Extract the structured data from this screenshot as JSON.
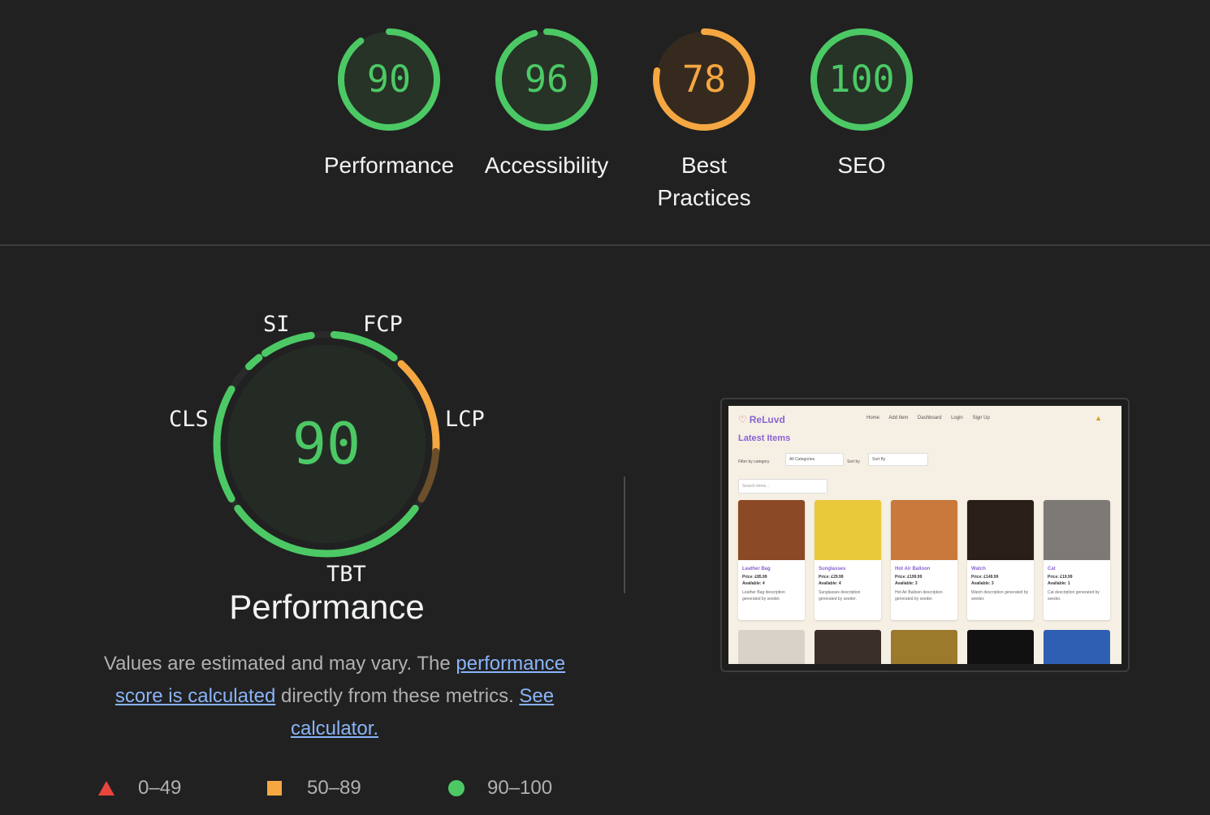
{
  "colors": {
    "pass": "#4cc965",
    "average": "#f5a742",
    "fail": "#e8453c",
    "pass_bg": "#263326",
    "average_bg": "#362a1e"
  },
  "categories": [
    {
      "score": "90",
      "label": "Performance",
      "value": 90,
      "rating": "pass"
    },
    {
      "score": "96",
      "label": "Accessibility",
      "value": 96,
      "rating": "pass"
    },
    {
      "score": "78",
      "label": "Best Practices",
      "value": 78,
      "rating": "average"
    },
    {
      "score": "100",
      "label": "SEO",
      "value": 100,
      "rating": "pass"
    }
  ],
  "performance": {
    "score": "90",
    "title": "Performance",
    "metrics": [
      {
        "label": "SI",
        "rating": "pass"
      },
      {
        "label": "FCP",
        "rating": "pass"
      },
      {
        "label": "LCP",
        "rating": "average"
      },
      {
        "label": "TBT",
        "rating": "pass"
      },
      {
        "label": "CLS",
        "rating": "pass"
      }
    ],
    "description_prefix": "Values are estimated and may vary. The ",
    "link_score": "performance score is calculated",
    "description_middle": " directly from these metrics. ",
    "link_calculator": "See calculator."
  },
  "legend": [
    {
      "range": "0–49",
      "icon": "triangle-icon"
    },
    {
      "range": "50–89",
      "icon": "square-icon"
    },
    {
      "range": "90–100",
      "icon": "circle-icon"
    }
  ],
  "screenshot": {
    "logo": "ReLuvd",
    "nav": [
      "Home",
      "Add Item",
      "Dashboard",
      "Login",
      "Sign Up"
    ],
    "heading": "Latest Items",
    "filter_label": "Filter by category",
    "filter_value": "All Categories",
    "sort_label": "Sort by",
    "sort_value": "Sort By",
    "search_placeholder": "Search items...",
    "items": [
      {
        "title": "Leather Bag",
        "price": "Price: £85.99",
        "available": "Available: 4",
        "desc": "Leather Bag description generated by seeder.",
        "color": "#8b4a25"
      },
      {
        "title": "Sunglasses",
        "price": "Price: £29.99",
        "available": "Available: 4",
        "desc": "Sunglasses description generated by seeder.",
        "color": "#e9c93a"
      },
      {
        "title": "Hot Air Balloon",
        "price": "Price: £199.99",
        "available": "Available: 3",
        "desc": "Hot Air Balloon description generated by seeder.",
        "color": "#c9793c"
      },
      {
        "title": "Watch",
        "price": "Price: £149.99",
        "available": "Available: 3",
        "desc": "Watch description generated by seeder.",
        "color": "#2a1f18"
      },
      {
        "title": "Cat",
        "price": "Price: £19.99",
        "available": "Available: 1",
        "desc": "Cat description generated by seeder.",
        "color": "#7d7a76"
      }
    ],
    "row2_colors": [
      "#d9d2c9",
      "#3b2f2a",
      "#9b7a2c",
      "#111111",
      "#2f5fb3"
    ]
  }
}
